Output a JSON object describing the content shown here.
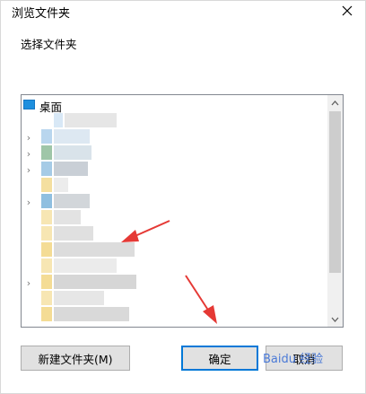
{
  "window": {
    "title": "浏览文件夹"
  },
  "prompt": "选择文件夹",
  "tree": {
    "root_label": "桌面"
  },
  "buttons": {
    "new_folder": "新建文件夹(M)",
    "ok": "确定",
    "cancel": "取消"
  },
  "watermark": "Baidu 经验",
  "colors": {
    "accent": "#0078d7",
    "annotation_arrow": "#e53935"
  }
}
